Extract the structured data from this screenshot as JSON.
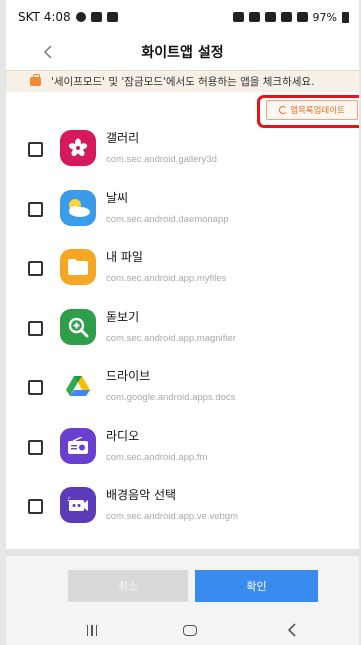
{
  "status_bar": {
    "left": "SKT 4:08",
    "right": "97%"
  },
  "header": {
    "back_icon": "chevron-left-icon",
    "title": "화이트앱 설정"
  },
  "notice": {
    "icon": "briefcase-icon",
    "text": "'세이프모드' 및 '잠금모드'에서도 허용하는 앱을 체크하세요."
  },
  "update_button": {
    "icon": "refresh-icon",
    "label": "앱목록업데이트"
  },
  "apps": [
    {
      "name": "갤러리",
      "package": "com.sec.android.gallery3d",
      "checked": false,
      "icon": "gallery-icon",
      "color": "#d6195c"
    },
    {
      "name": "날씨",
      "package": "com.sec.android.daemonapp",
      "checked": false,
      "icon": "weather-icon",
      "color": "#3a9be8"
    },
    {
      "name": "내 파일",
      "package": "com.sec.android.app.myfiles",
      "checked": false,
      "icon": "folder-icon",
      "color": "#f5a623"
    },
    {
      "name": "돋보기",
      "package": "com.sec.android.app.magnifier",
      "checked": false,
      "icon": "magnifier-icon",
      "color": "#2e9e4a"
    },
    {
      "name": "드라이브",
      "package": "com.google.android.apps.docs",
      "checked": false,
      "icon": "drive-icon",
      "color": "#ffffff"
    },
    {
      "name": "라디오",
      "package": "com.sec.android.app.fm",
      "checked": false,
      "icon": "radio-icon",
      "color": "#6a3fcf"
    },
    {
      "name": "배경음악 선택",
      "package": "com.sec.android.app.ve.vebgm",
      "checked": false,
      "icon": "bgm-icon",
      "color": "#5b3bb8"
    }
  ],
  "buttons": {
    "cancel": "취소",
    "confirm": "확인"
  },
  "nav": {
    "recent": "recent-apps-icon",
    "home": "home-icon",
    "back": "back-icon"
  }
}
